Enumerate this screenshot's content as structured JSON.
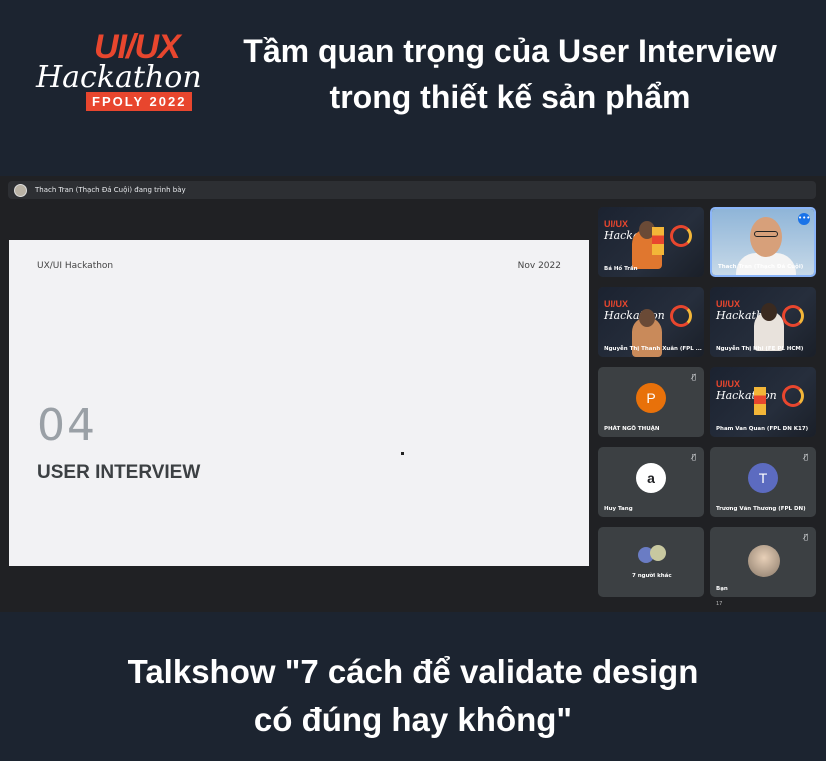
{
  "logo": {
    "uiux": "UI/UX",
    "hackathon": "Hackathon",
    "year_badge": "FPOLY 2022"
  },
  "headline": {
    "line1": "Tầm quan trọng của User Interview",
    "line2": "trong thiết kế sản phẩm"
  },
  "meet": {
    "presenter_text": "Thach Tran (Thạch Đá Cuội) đang trình bày",
    "slide": {
      "brand": "UX/UI Hackathon",
      "date": "Nov 2022",
      "number": "04",
      "title": "USER INTERVIEW"
    },
    "participants": [
      {
        "name": "Bá Hồ Trần"
      },
      {
        "name": "Thach Tran (Thạch Đá Cuội)"
      },
      {
        "name": "Nguyễn Thị Thanh Xuân (FPL ..."
      },
      {
        "name": "Nguyễn Thị Nhi (FE PL HCM)"
      },
      {
        "name": "PHÁT NGÔ THUẬN",
        "initial": "P",
        "color": "#e8710a"
      },
      {
        "name": "Pham Van Quan (FPL DN K17)"
      },
      {
        "name": "Huy Tang",
        "initial": "a",
        "color": "#ffffff"
      },
      {
        "name": "Trương Văn Thương (FPL DN)",
        "initial": "T",
        "color": "#5c6bc0"
      },
      {
        "name": "7 người khác"
      },
      {
        "name": "Bạn"
      }
    ],
    "more_btn": "•••",
    "mute_glyph": "🎙̸",
    "footer_count": "17"
  },
  "caption": {
    "line1": "Talkshow \"7 cách để validate design",
    "line2": "có đúng hay không\""
  }
}
